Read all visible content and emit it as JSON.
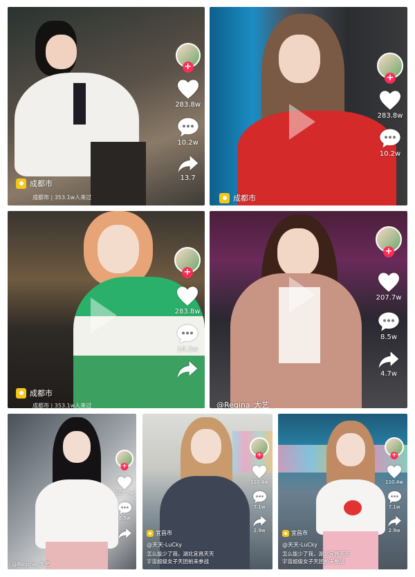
{
  "tiles": [
    {
      "location": "成都市",
      "sub": "成都市 | 353.1w人来过",
      "likes": "283.8w",
      "comments": "10.2w",
      "shares": "13.7"
    },
    {
      "location": "成都市",
      "likes": "283.8w",
      "comments": "10.2w"
    },
    {
      "location": "成都市",
      "sub": "成都市 | 353.1w人来过",
      "likes": "283.8w",
      "comments": "10.2w"
    },
    {
      "user": "@Regina_大艺",
      "likes": "207.7w",
      "comments": "8.5w",
      "shares": "4.7w"
    },
    {
      "user": "@Regina_大艺",
      "likes": "207.7w",
      "comments": "8.5w"
    },
    {
      "location": "宜昌市",
      "user": "@天天-LuCky",
      "caption_line1": "怎么能少了我，湖北宜昌天天",
      "caption_line2": "宇宙超级女子天团前来参战",
      "likes": "110.4w",
      "comments": "7.1w",
      "shares": "2.9w"
    },
    {
      "location": "宜昌市",
      "user": "@天天-LuCky",
      "caption_line1": "怎么能少了我，湖北宜昌天天",
      "caption_line2": "宇宙超级女子天团前来参战",
      "likes": "110.4w",
      "comments": "7.1w",
      "shares": "2.9w"
    }
  ],
  "colors": {
    "plus": "#fe2c55",
    "pin": "#f7c619"
  }
}
